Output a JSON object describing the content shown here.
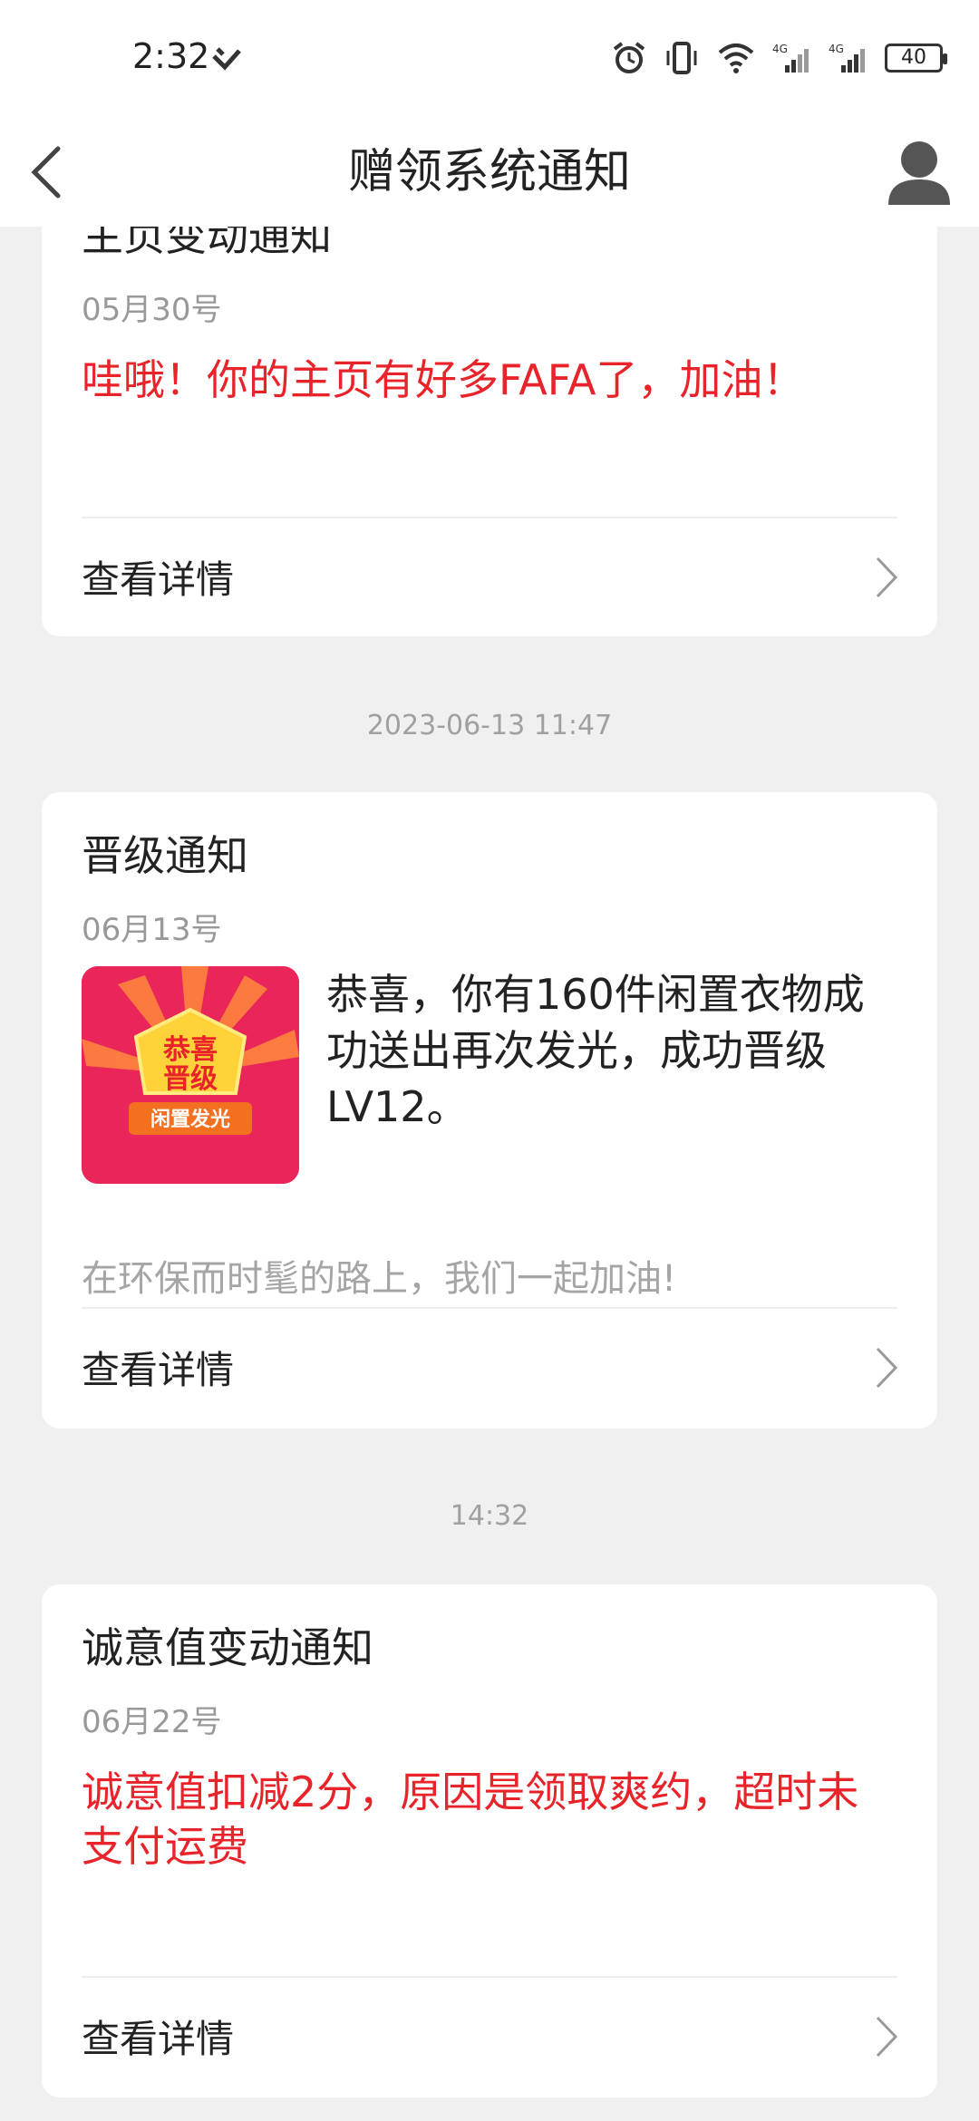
{
  "status": {
    "time": "2:32",
    "battery": "40"
  },
  "nav": {
    "title": "赠领系统通知"
  },
  "detail_label": "查看详情",
  "cards": [
    {
      "title": "主页变动通知",
      "date": "05月30号",
      "message": "哇哦！你的主页有好多FAFA了，加油！"
    },
    {
      "title": "晋级通知",
      "date": "06月13号",
      "message": "恭喜，你有160件闲置衣物成功送出再次发光，成功晋级LV12。",
      "thumbnail_text_1": "恭喜",
      "thumbnail_text_2": "晋级",
      "thumbnail_banner": "闲置发光",
      "footer": "在环保而时髦的路上，我们一起加油!"
    },
    {
      "title": "诚意值变动通知",
      "date": "06月22号",
      "message": "诚意值扣减2分，原因是领取爽约，超时未支付运费"
    }
  ],
  "timestamps": [
    "2023-06-13 11:47",
    "14:32"
  ],
  "colors": {
    "accent_red": "#e8232a",
    "thumbnail_bg": "#e9255a"
  }
}
